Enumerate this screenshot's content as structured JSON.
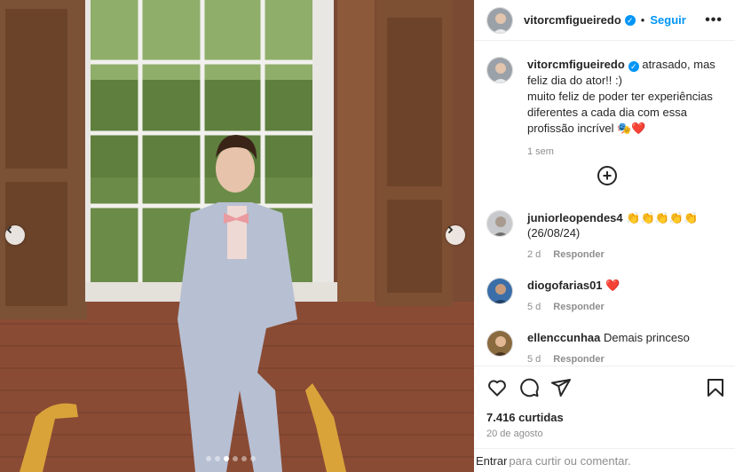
{
  "post": {
    "author": "vitorcmfigueiredo",
    "verified_icon": "verified-badge-icon",
    "separator": "•",
    "follow_label": "Seguir",
    "more_icon": "more-options-icon"
  },
  "caption": {
    "author": "vitorcmfigueiredo",
    "line1": "atrasado, mas feliz dia do ator!! :)",
    "line2": "muito feliz de poder ter experiências diferentes a cada dia com essa profissão incrível 🎭❤️",
    "time": "1 sem"
  },
  "comments": [
    {
      "user": "juniorleopendes4",
      "text": "👏👏👏👏👏 (26/08/24)",
      "age": "2 d",
      "reply": "Responder"
    },
    {
      "user": "diogofarias01",
      "text": "❤️",
      "age": "5 d",
      "reply": "Responder"
    },
    {
      "user": "ellenccunhaa",
      "text": "Demais princeso",
      "age": "5 d",
      "reply": "Responder"
    }
  ],
  "actions": {
    "like_icon": "heart-icon",
    "comment_icon": "comment-icon",
    "share_icon": "share-icon",
    "save_icon": "bookmark-icon"
  },
  "likes": "7.416 curtidas",
  "date": "20 de agosto",
  "comment_input": {
    "prefix": "Entrar",
    "placeholder": "para curtir ou comentar."
  },
  "carousel": {
    "slides": 6,
    "active_index": 2
  },
  "colors": {
    "accent": "#0095f6",
    "heart": "#ed4956"
  }
}
